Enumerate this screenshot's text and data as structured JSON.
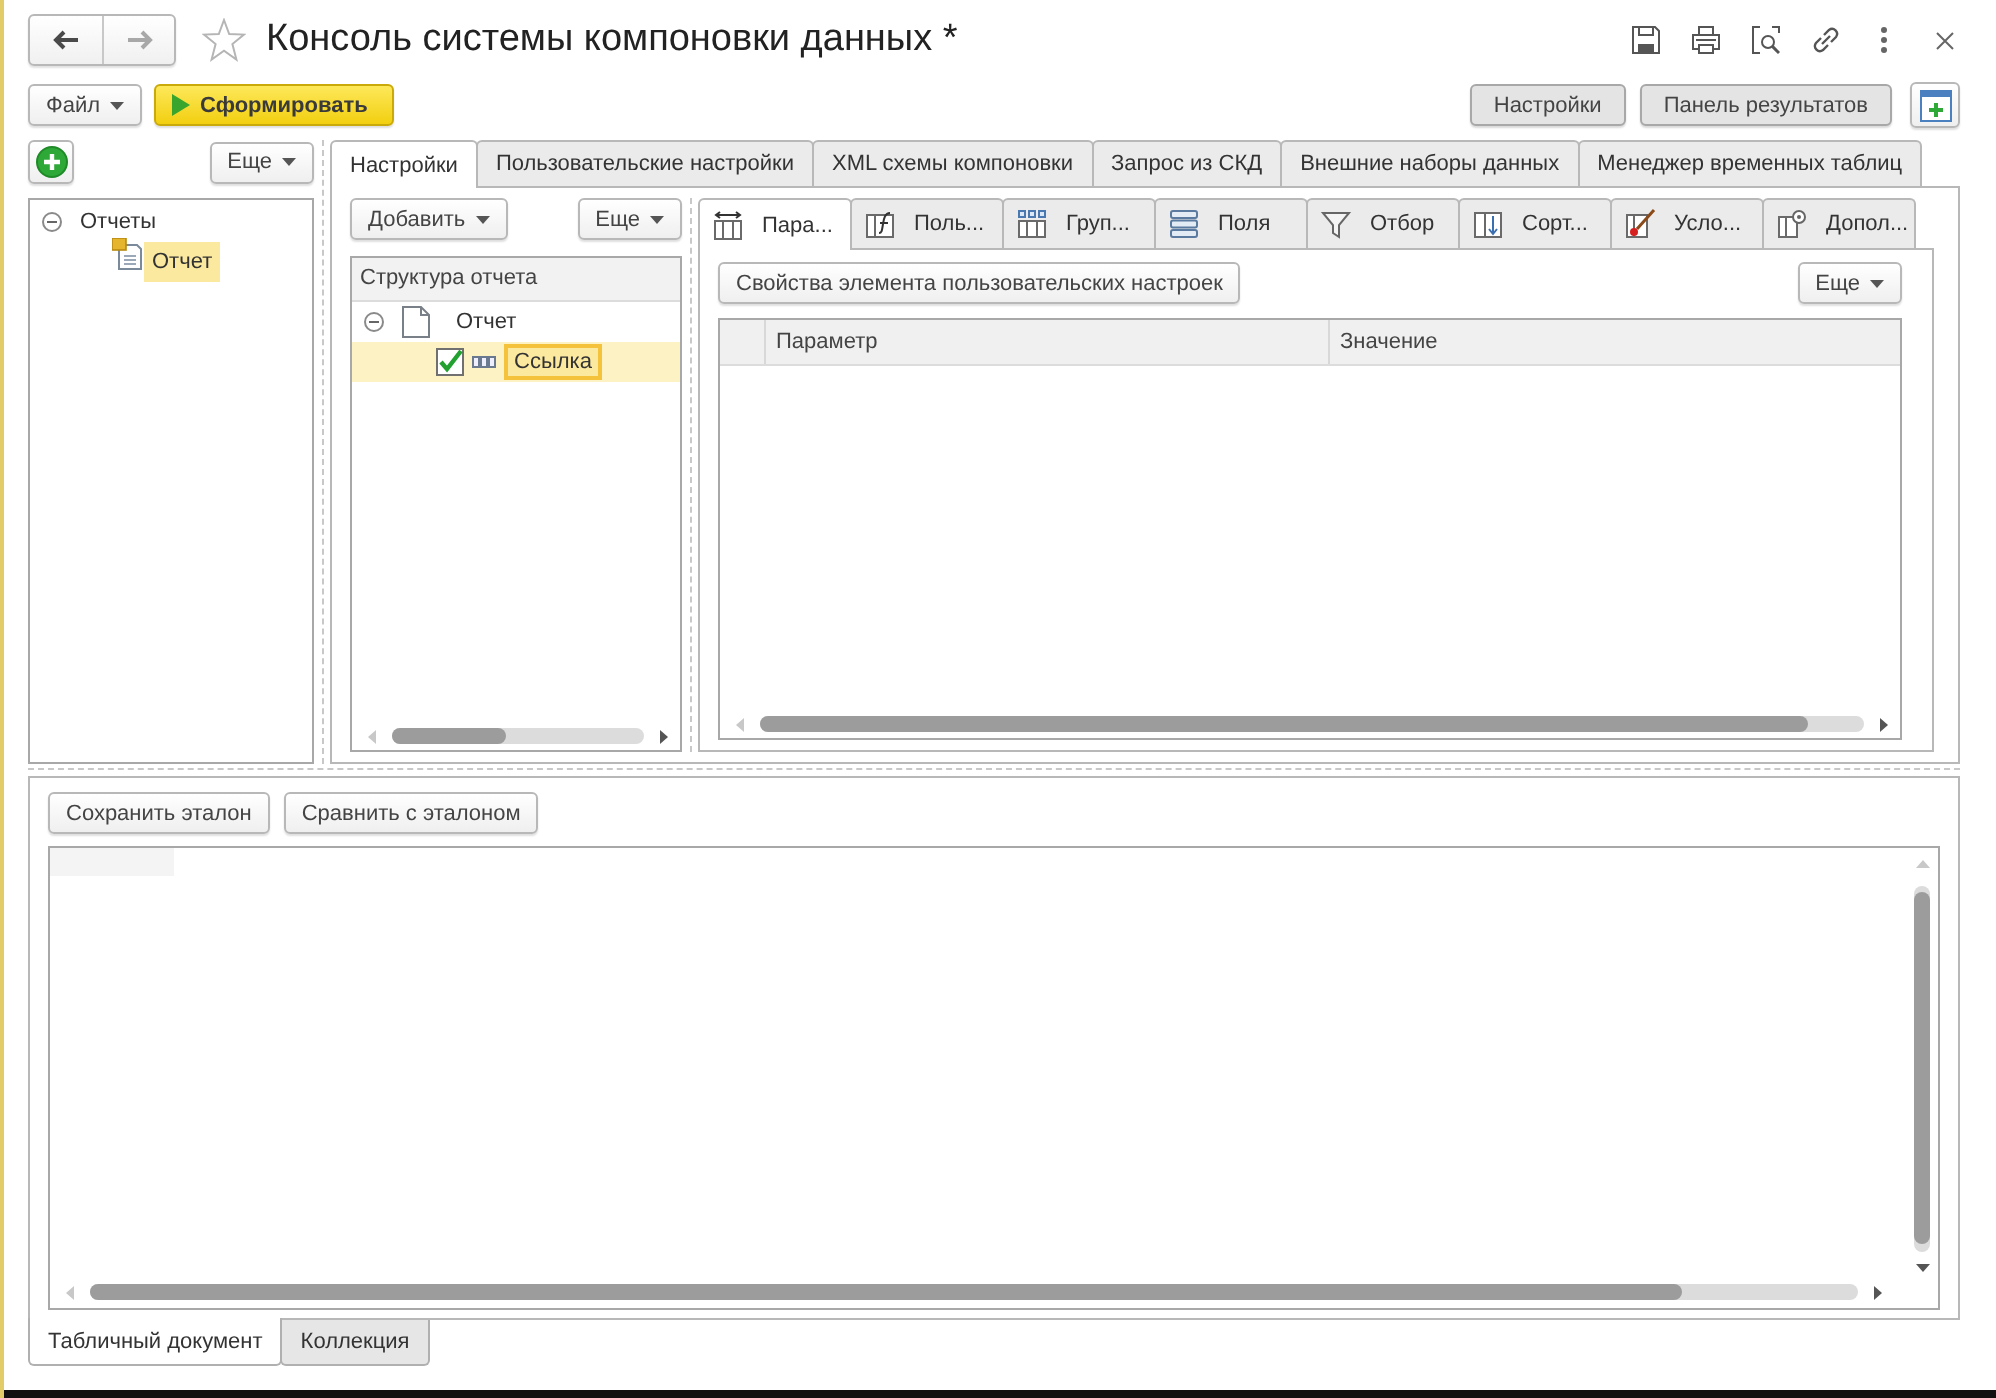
{
  "window": {
    "title": "Консоль системы компоновки данных *",
    "favorite": false
  },
  "navigation": [
    {
      "kind": "back",
      "disabled": false
    },
    {
      "kind": "forward",
      "disabled": true
    }
  ],
  "toolbar": {
    "file_menu": "Файл",
    "run_button": "Сформировать",
    "panel_buttons": [
      "Настройки",
      "Панель результатов"
    ]
  },
  "reports_panel": {
    "more_button": "Еще",
    "tree": [
      {
        "label": "Отчеты",
        "expanded": true,
        "selected": false,
        "children": [
          {
            "label": "Отчет",
            "selected": true
          }
        ]
      }
    ]
  },
  "main_tabs": [
    {
      "label": "Настройки",
      "selected": true
    },
    {
      "label": "Пользовательские настройки",
      "selected": false
    },
    {
      "label": "XML схемы компоновки",
      "selected": false
    },
    {
      "label": "Запрос из СКД",
      "selected": false
    },
    {
      "label": "Внешние наборы данных",
      "selected": false
    },
    {
      "label": "Менеджер временных таблиц",
      "selected": false
    }
  ],
  "settings": {
    "add_button": "Добавить",
    "more_button": "Еще",
    "structure": {
      "header": "Структура отчета",
      "tree": [
        {
          "label": "Отчет",
          "expanded": true,
          "selected": false,
          "children": [
            {
              "label": "Ссылка",
              "checked": true,
              "selected": true
            }
          ]
        }
      ]
    },
    "tabs": [
      {
        "label": "Пара...",
        "selected": true
      },
      {
        "label": "Поль...",
        "selected": false
      },
      {
        "label": "Груп...",
        "selected": false
      },
      {
        "label": "Поля",
        "selected": false
      },
      {
        "label": "Отбор",
        "selected": false
      },
      {
        "label": "Сорт...",
        "selected": false
      },
      {
        "label": "Усло...",
        "selected": false
      },
      {
        "label": "Допол...",
        "selected": false
      }
    ],
    "properties_button": "Свойства элемента пользовательских настроек",
    "properties_more_button": "Еще",
    "table": {
      "columns": [
        "Параметр",
        "Значение"
      ]
    }
  },
  "results_panel": {
    "buttons": [
      "Сохранить эталон",
      "Сравнить с эталоном"
    ],
    "tabs": [
      {
        "label": "Табличный документ",
        "selected": true
      },
      {
        "label": "Коллекция",
        "selected": false
      }
    ]
  }
}
